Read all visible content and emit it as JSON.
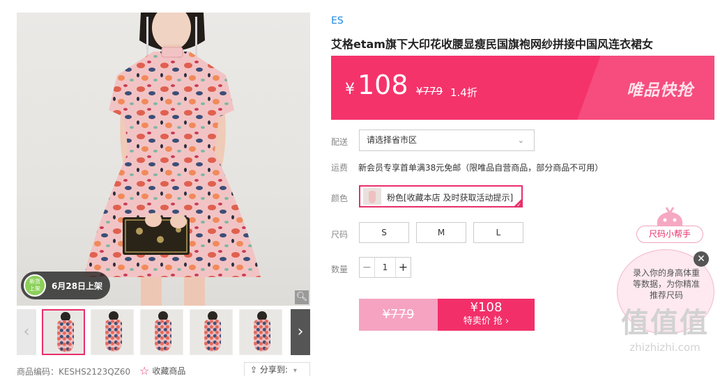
{
  "gallery": {
    "badge_line1": "新货",
    "badge_line2": "上架",
    "badge_text": "6月28日上架",
    "zoom_icon": "magnifier-icon",
    "prev_icon": "‹",
    "next_icon": "›",
    "thumbnail_count": 5
  },
  "meta": {
    "product_code": "商品编码：KESHS2123QZ60",
    "favorite_label": "收藏商品",
    "share_label": "分享到:"
  },
  "product": {
    "brand": "ES",
    "title": "艾格etam旗下大印花收腰显瘦民国旗袍网纱拼接中国风连衣裙女"
  },
  "price": {
    "currency": "¥",
    "current": "108",
    "original": "¥779",
    "discount": "1.4折",
    "promo_logo": "唯品快抢",
    "banner_color": "#f5336b"
  },
  "delivery": {
    "label": "配送",
    "placeholder": "请选择省市区"
  },
  "shipping": {
    "label": "运费",
    "text": "新会员专享首单满38元免邮（限唯品自营商品，部分商品不可用）"
  },
  "color": {
    "label": "颜色",
    "selected": "粉色[收藏本店 及时获取活动提示]"
  },
  "size": {
    "label": "尺码",
    "options": [
      "S",
      "M",
      "L"
    ]
  },
  "quantity": {
    "label": "数量",
    "value": "1",
    "minus": "−",
    "plus": "+"
  },
  "buy": {
    "original_price": "¥779",
    "sale_price": "¥108",
    "sale_label": "特卖价 抢 ›"
  },
  "size_helper": {
    "title": "尺码小帮手",
    "text": "录入你的身高体重等数据，为你精准推荐尺码",
    "close": "✕"
  },
  "watermark": {
    "logo": "值值值",
    "url": "zhizhizhi.com"
  }
}
